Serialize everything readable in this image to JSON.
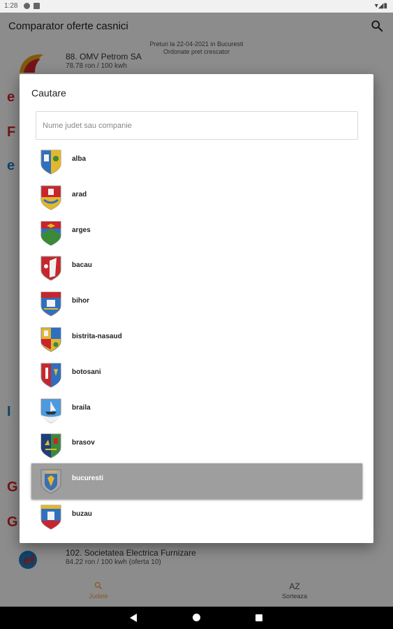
{
  "status_bar": {
    "time": "1:28",
    "right": "▾◢▮"
  },
  "app_bar": {
    "title": "Comparator oferte casnici",
    "search_icon": "search-icon"
  },
  "background": {
    "info_line1": "Preturi la 22-04-2021 in Bucuresti",
    "info_line2": "Ordonate pret crescator",
    "top_item": {
      "name": "88. OMV Petrom SA",
      "price": "78.78 ron / 100 kwh"
    },
    "bottom_item": {
      "name": "102. Societatea Electrica Furnizare",
      "price": "84.22 ron / 100 kwh (oferta 10)"
    }
  },
  "bottom_nav": {
    "judete_label": "Judete",
    "sorteaza_label": "Sorteaza",
    "sorteaza_icon_text": "AZ",
    "active_color": "#f3a43b"
  },
  "dialog": {
    "title": "Cautare",
    "search_placeholder": "Nume judet sau companie",
    "items": [
      {
        "label": "alba",
        "icon": "alba-crest-icon"
      },
      {
        "label": "arad",
        "icon": "arad-crest-icon"
      },
      {
        "label": "arges",
        "icon": "arges-crest-icon"
      },
      {
        "label": "bacau",
        "icon": "bacau-crest-icon"
      },
      {
        "label": "bihor",
        "icon": "bihor-crest-icon"
      },
      {
        "label": "bistrita-nasaud",
        "icon": "bistrita-nasaud-crest-icon"
      },
      {
        "label": "botosani",
        "icon": "botosani-crest-icon"
      },
      {
        "label": "braila",
        "icon": "braila-crest-icon"
      },
      {
        "label": "brasov",
        "icon": "brasov-crest-icon"
      },
      {
        "label": "bucuresti",
        "icon": "bucuresti-crest-icon",
        "selected": true
      },
      {
        "label": "buzau",
        "icon": "buzau-crest-icon"
      }
    ]
  }
}
